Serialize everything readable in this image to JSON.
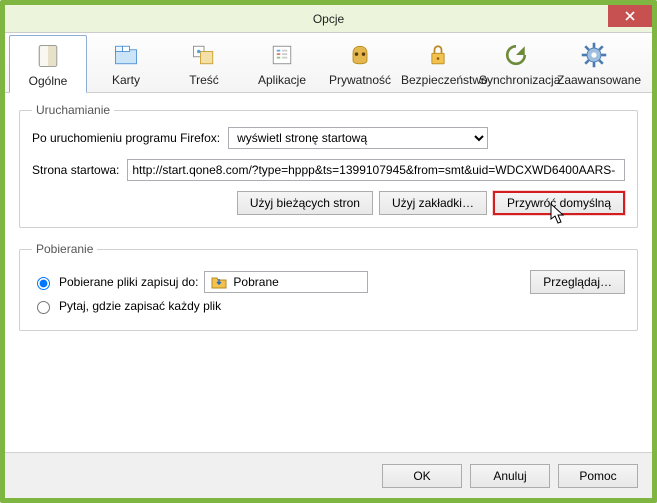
{
  "window": {
    "title": "Opcje"
  },
  "tabs": [
    {
      "id": "general",
      "label": "Ogólne"
    },
    {
      "id": "tabs",
      "label": "Karty"
    },
    {
      "id": "content",
      "label": "Treść"
    },
    {
      "id": "apps",
      "label": "Aplikacje"
    },
    {
      "id": "privacy",
      "label": "Prywatność"
    },
    {
      "id": "security",
      "label": "Bezpieczeństwo"
    },
    {
      "id": "sync",
      "label": "Synchronizacja"
    },
    {
      "id": "advanced",
      "label": "Zaawansowane"
    }
  ],
  "startup": {
    "legend": "Uruchamianie",
    "onstart_label": "Po uruchomieniu programu Firefox:",
    "onstart_value": "wyświetl stronę startową",
    "homepage_label": "Strona startowa:",
    "homepage_value": "http://start.qone8.com/?type=hppp&ts=1399107945&from=smt&uid=WDCXWD6400AARS-",
    "btn_current": "Użyj bieżących stron",
    "btn_bookmark": "Użyj zakładki…",
    "btn_restore": "Przywróć domyślną"
  },
  "downloads": {
    "legend": "Pobieranie",
    "save_to_label": "Pobierane pliki zapisuj do:",
    "folder_value": "Pobrane",
    "browse_btn": "Przeglądaj…",
    "ask_label": "Pytaj, gdzie zapisać każdy plik"
  },
  "footer": {
    "ok": "OK",
    "cancel": "Anuluj",
    "help": "Pomoc"
  }
}
